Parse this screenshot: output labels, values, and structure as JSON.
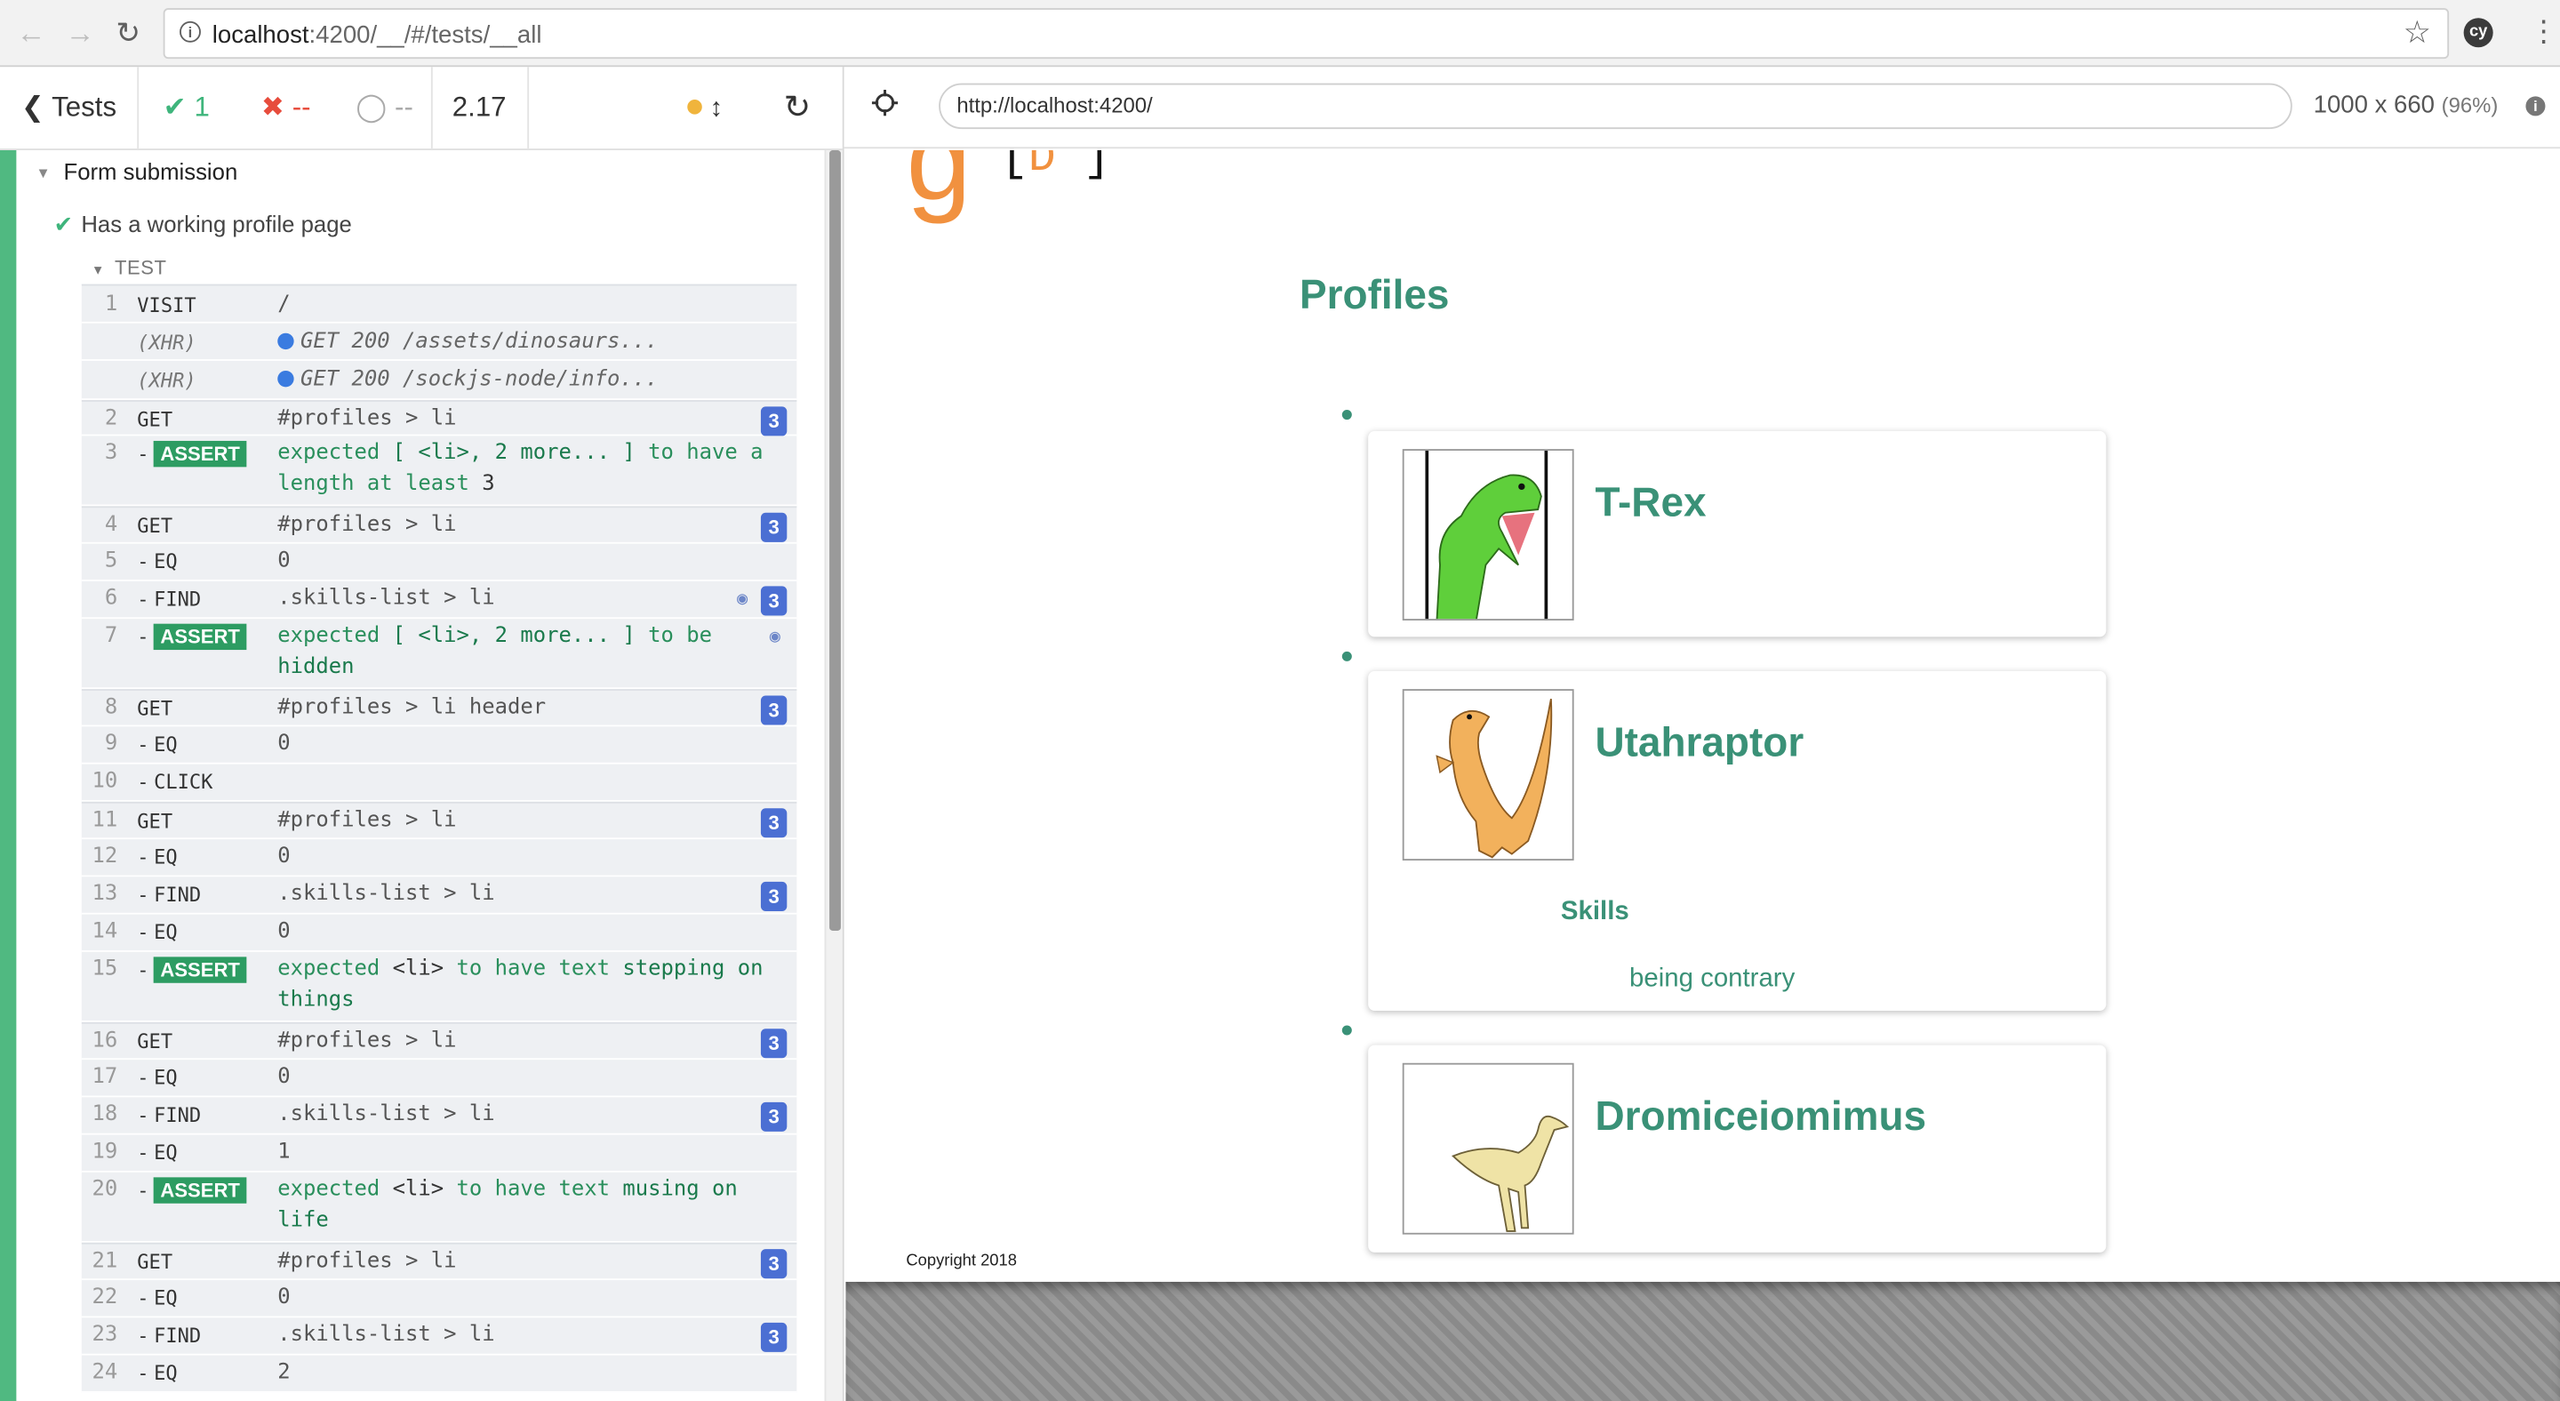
{
  "browser": {
    "url_host": "localhost",
    "url_rest": ":4200/__/#/tests/__all",
    "extension_label": "cy",
    "back_glyph": "←",
    "forward_glyph": "→",
    "reload_glyph": "↻",
    "star_glyph": "☆",
    "menu_glyph": "⋮"
  },
  "reporter": {
    "tests_label": "Tests",
    "passed": "1",
    "failed": "--",
    "pending": "--",
    "duration": "2.17",
    "suite_title": "Form submission",
    "test_title": "Has a working profile page",
    "section_label": "TEST",
    "commands": [
      {
        "num": "1",
        "name": "VISIT",
        "msg": "/"
      },
      {
        "num": "",
        "name": "(XHR)",
        "msg": "GET 200 /assets/dinosaurs..."
      },
      {
        "num": "",
        "name": "(XHR)",
        "msg": "GET 200 /sockjs-node/info..."
      },
      {
        "num": "2",
        "name": "GET",
        "msg": "#profiles > li",
        "count": "3"
      },
      {
        "num": "3",
        "name": "ASSERT",
        "msg_a": "expected",
        "msg_b": "[ <li>, 2 more... ]",
        "msg_c": "to have a length at least",
        "msg_d": "3"
      },
      {
        "num": "4",
        "name": "GET",
        "msg": "#profiles > li",
        "count": "3"
      },
      {
        "num": "5",
        "name": "EQ",
        "msg": "0"
      },
      {
        "num": "6",
        "name": "FIND",
        "msg": ".skills-list > li",
        "count": "3"
      },
      {
        "num": "7",
        "name": "ASSERT",
        "msg_a": "expected",
        "msg_b": "[ <li>, 2 more... ]",
        "msg_c": "to be",
        "msg_d": "hidden"
      },
      {
        "num": "8",
        "name": "GET",
        "msg": "#profiles > li header",
        "count": "3"
      },
      {
        "num": "9",
        "name": "EQ",
        "msg": "0"
      },
      {
        "num": "10",
        "name": "CLICK",
        "msg": ""
      },
      {
        "num": "11",
        "name": "GET",
        "msg": "#profiles > li",
        "count": "3"
      },
      {
        "num": "12",
        "name": "EQ",
        "msg": "0"
      },
      {
        "num": "13",
        "name": "FIND",
        "msg": ".skills-list > li",
        "count": "3"
      },
      {
        "num": "14",
        "name": "EQ",
        "msg": "0"
      },
      {
        "num": "15",
        "name": "ASSERT",
        "msg_a": "expected",
        "msg_b": "<li>",
        "msg_c": "to have text",
        "msg_d": "stepping on things"
      },
      {
        "num": "16",
        "name": "GET",
        "msg": "#profiles > li",
        "count": "3"
      },
      {
        "num": "17",
        "name": "EQ",
        "msg": "0"
      },
      {
        "num": "18",
        "name": "FIND",
        "msg": ".skills-list > li",
        "count": "3"
      },
      {
        "num": "19",
        "name": "EQ",
        "msg": "1"
      },
      {
        "num": "20",
        "name": "ASSERT",
        "msg_a": "expected",
        "msg_b": "<li>",
        "msg_c": "to have text",
        "msg_d": "musing on life"
      },
      {
        "num": "21",
        "name": "GET",
        "msg": "#profiles > li",
        "count": "3"
      },
      {
        "num": "22",
        "name": "EQ",
        "msg": "0"
      },
      {
        "num": "23",
        "name": "FIND",
        "msg": ".skills-list > li",
        "count": "3"
      },
      {
        "num": "24",
        "name": "EQ",
        "msg": "2"
      }
    ]
  },
  "app_header": {
    "url": "http://localhost:4200/",
    "viewport": "1000 x 660",
    "scale": "(96%)"
  },
  "aut": {
    "page_title": "Profiles",
    "profiles": [
      {
        "name": "T-Rex"
      },
      {
        "name": "Utahraptor",
        "skills_heading": "Skills",
        "skill": "being contrary"
      },
      {
        "name": "Dromiceiomimus"
      }
    ],
    "copyright": "Copyright 2018"
  },
  "colors": {
    "brand_green": "#3a9177",
    "pass_green": "#3fb57c",
    "logo_orange": "#f1913f",
    "count_blue": "#4b6fd3"
  }
}
